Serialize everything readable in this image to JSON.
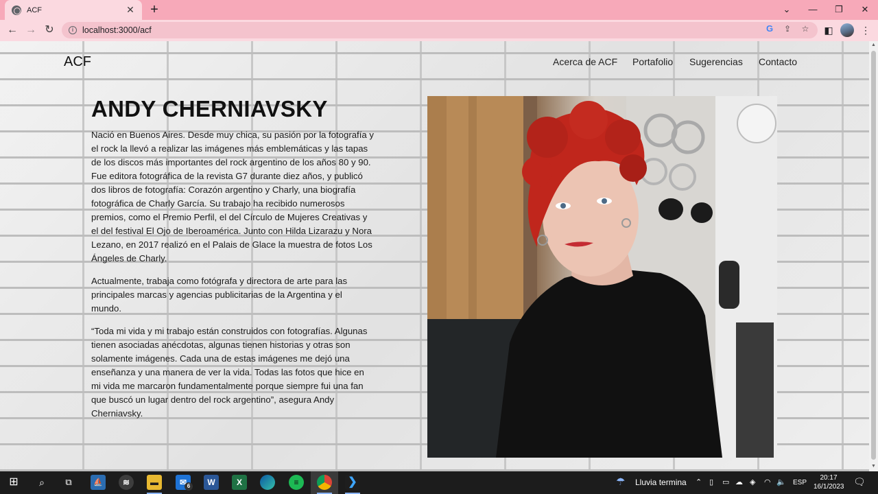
{
  "browser": {
    "tab_title": "ACF",
    "tab_close": "✕",
    "new_tab": "+",
    "url": "localhost:3000/acf",
    "google_letter": "G"
  },
  "site": {
    "logo": "ACF",
    "nav": [
      "Acerca de ACF",
      "Portafolio",
      "Sugerencias",
      "Contacto"
    ]
  },
  "content": {
    "title": "ANDY CHERNIAVSKY",
    "paragraphs": [
      "Nació en Buenos Aires. Desde muy chica, su pasión por la fotografía y el rock la llevó a realizar las imágenes más emblemáticas y las tapas de los discos más importantes del rock argentino de los años 80 y 90. Fue editora fotográfica de la revista G7 durante diez años, y publicó dos libros de fotografía: Corazón argentino y Charly, una biografía fotográfica de Charly García. Su trabajo ha recibido numerosos premios, como el Premio Perfil, el del Círculo de Mujeres Creativas y el del festival El Ojo de Iberoamérica. Junto con Hilda Lizarazu y Nora Lezano, en 2017 realizó en el Palais de Glace la muestra de fotos Los Ángeles de Charly.",
      "Actualmente, trabaja como fotógrafa y directora de arte para las principales marcas y agencias publicitarias de la Argentina y el mundo.",
      "“Toda mi vida y mi trabajo están construidos con fotografías. Algunas tienen asociadas anécdotas, algunas tienen historias y otras son solamente imágenes. Cada una de estas imágenes me dejó una enseñanza y una manera de ver la vida. Todas las fotos que hice en mi vida me marcaron fundamentalmente porque siempre fui una fan que buscó un lugar dentro del rock argentino”, asegura Andy Cherniavsky."
    ]
  },
  "taskbar": {
    "mail_badge": "6",
    "word_letter": "W",
    "excel_letter": "X",
    "weather": "Lluvia termina",
    "language": "ESP",
    "time": "20:17",
    "date": "16/1/2023"
  },
  "colors": {
    "tabstrip": "#f7a9b9",
    "toolbar": "#fbd9e0",
    "taskbar": "#1c1c1c",
    "hair": "#c0261c"
  }
}
